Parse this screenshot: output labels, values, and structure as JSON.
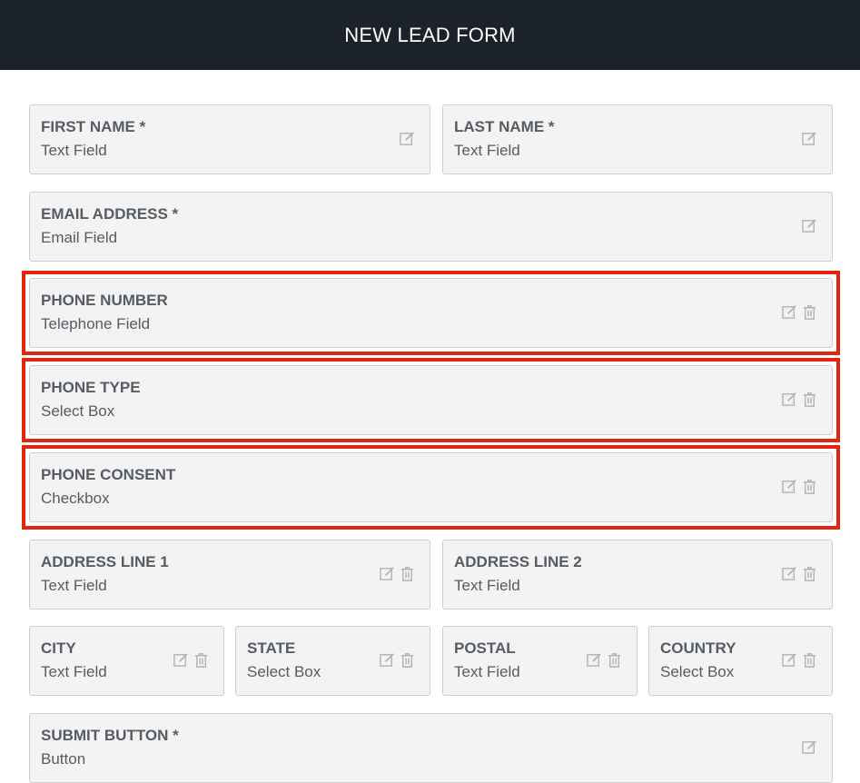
{
  "header": {
    "title": "NEW LEAD FORM"
  },
  "fields": [
    {
      "label": "FIRST NAME *",
      "type": "Text Field"
    },
    {
      "label": "LAST NAME *",
      "type": "Text Field"
    },
    {
      "label": "EMAIL ADDRESS *",
      "type": "Email Field"
    },
    {
      "label": "PHONE NUMBER",
      "type": "Telephone Field"
    },
    {
      "label": "PHONE TYPE",
      "type": "Select Box"
    },
    {
      "label": "PHONE CONSENT",
      "type": "Checkbox"
    },
    {
      "label": "ADDRESS LINE 1",
      "type": "Text Field"
    },
    {
      "label": "ADDRESS LINE 2",
      "type": "Text Field"
    },
    {
      "label": "CITY",
      "type": "Text Field"
    },
    {
      "label": "STATE",
      "type": "Select Box"
    },
    {
      "label": "POSTAL",
      "type": "Text Field"
    },
    {
      "label": "COUNTRY",
      "type": "Select Box"
    },
    {
      "label": "SUBMIT BUTTON *",
      "type": "Button"
    }
  ],
  "icons": {
    "edit": "edit-icon",
    "delete": "trash-icon"
  },
  "colors": {
    "header_bg": "#1b2229",
    "highlight": "#e5260e",
    "field_bg": "#f3f3f3",
    "text": "#555c63"
  }
}
